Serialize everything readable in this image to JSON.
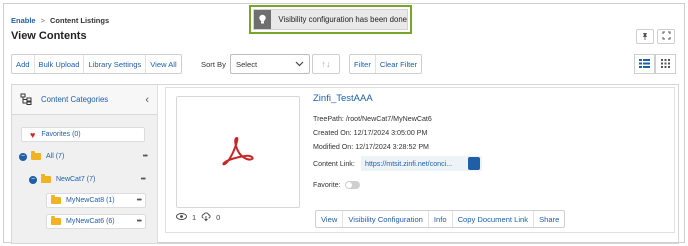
{
  "breadcrumb": {
    "root": "Enable",
    "separator": ">",
    "current": "Content Listings"
  },
  "page_title": "View Contents",
  "toast": {
    "message": "Visibility configuration has been done",
    "icon": "lightbulb-icon"
  },
  "top_right": {
    "pin_icon": "pin-icon",
    "expand_icon": "expand-icon"
  },
  "toolbar": {
    "buttons": [
      "Add",
      "Bulk Upload",
      "Library Settings",
      "View All"
    ],
    "sort_label": "Sort By",
    "sort_select_value": "Select",
    "sort_arrows": "↑↓",
    "filter_buttons": [
      "Filter",
      "Clear Filter"
    ],
    "view_icons": [
      "list-view-icon",
      "grid-view-icon"
    ]
  },
  "sidebar": {
    "title": "Content Categories",
    "items": [
      {
        "label": "Favorites (0)",
        "icon": "heart-icon"
      },
      {
        "label": "All (7)",
        "icon": "folder-icon",
        "dots": "•••"
      },
      {
        "label": "NewCat7 (7)",
        "icon": "folder-icon",
        "dots": "•••"
      },
      {
        "label": "MyNewCat8 (1)",
        "icon": "folder-icon",
        "dots": "•••"
      },
      {
        "label": "MyNewCat6 (6)",
        "icon": "folder-icon",
        "dots": "•••"
      }
    ]
  },
  "content": {
    "title": "Zinfi_TestAAA",
    "tree_path_label": "TreePath:",
    "tree_path": "/root/NewCat7/MyNewCat6",
    "created_label": "Created On:",
    "created": "12/17/2024 3:05:00 PM",
    "modified_label": "Modified On:",
    "modified": "12/17/2024 3:28:52 PM",
    "link_label": "Content Link:",
    "link": "https://mtsit.zinfi.net/conci...",
    "favorite_label": "Favorite:",
    "favorite": false,
    "views": "1",
    "downloads": "0",
    "actions": [
      "View",
      "Visibility Configuration",
      "Info",
      "Copy Document Link",
      "Share"
    ]
  },
  "colors": {
    "accent": "#1f5fa8",
    "toast_border": "#7aa52c",
    "pdf_red": "#c62828",
    "folder": "#f0b323"
  }
}
